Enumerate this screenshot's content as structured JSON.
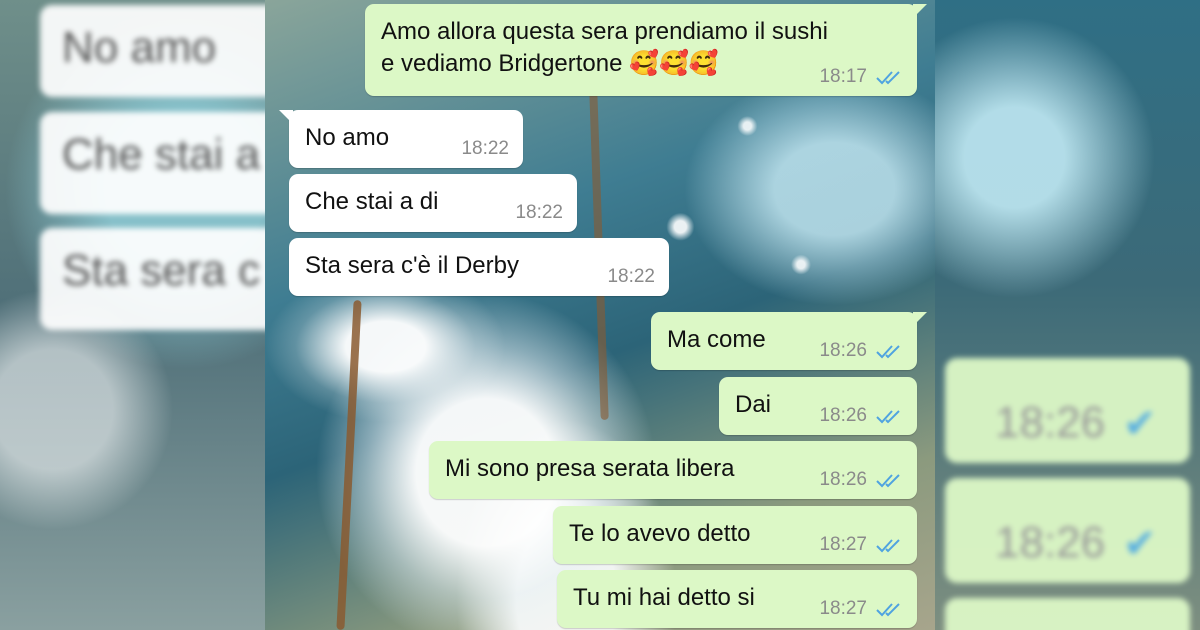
{
  "conversation": {
    "messages": [
      {
        "direction": "out",
        "text": "Amo allora questa sera prendiamo il sushi\ne vediamo Bridgertone 🥰🥰🥰",
        "time": "18:17",
        "status": "read"
      },
      {
        "direction": "in",
        "text": "No amo",
        "time": "18:22"
      },
      {
        "direction": "in",
        "text": "Che stai a di",
        "time": "18:22"
      },
      {
        "direction": "in",
        "text": "Sta sera c'è il Derby",
        "time": "18:22"
      },
      {
        "direction": "out",
        "text": "Ma come",
        "time": "18:26",
        "status": "read"
      },
      {
        "direction": "out",
        "text": "Dai",
        "time": "18:26",
        "status": "read"
      },
      {
        "direction": "out",
        "text": "Mi sono presa serata libera",
        "time": "18:26",
        "status": "read"
      },
      {
        "direction": "out",
        "text": "Te lo avevo detto",
        "time": "18:27",
        "status": "read"
      },
      {
        "direction": "out",
        "text": "Tu mi hai detto si",
        "time": "18:27",
        "status": "read"
      }
    ]
  },
  "blurred_left": [
    "No amo",
    "Che stai a",
    "Sta sera c"
  ],
  "blurred_right": [
    "18:26",
    "18:26"
  ],
  "colors": {
    "outgoing_bubble": "#dcf8c6",
    "incoming_bubble": "#ffffff",
    "read_tick": "#4fa3e0",
    "time_text": "#8a8a8a"
  }
}
